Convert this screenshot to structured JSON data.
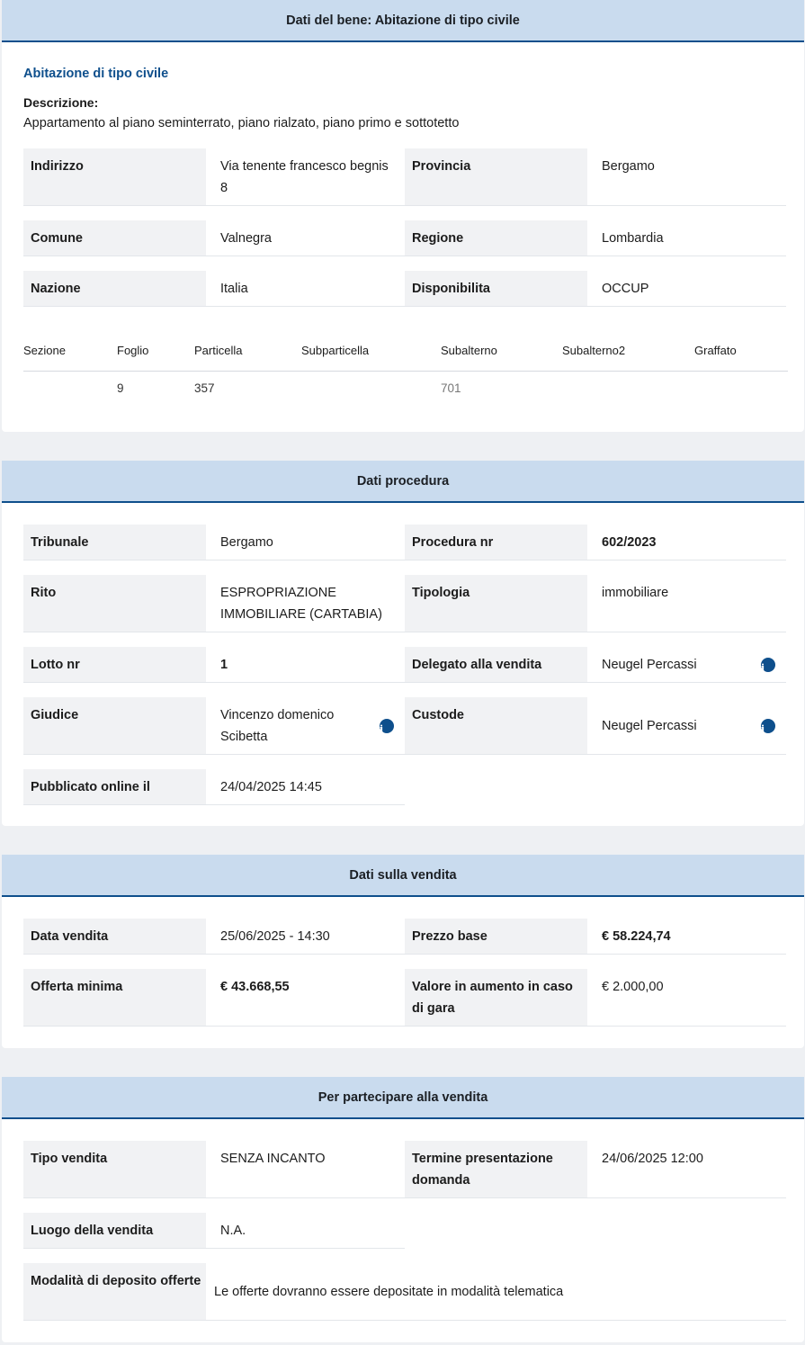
{
  "bene": {
    "header": "Dati del bene: Abitazione di tipo civile",
    "subtitle": "Abitazione di tipo civile",
    "description_label": "Descrizione:",
    "description": "Appartamento al piano seminterrato, piano rialzato, piano primo e sottotetto",
    "fields": {
      "indirizzo_label": "Indirizzo",
      "indirizzo_value": "Via tenente francesco begnis 8",
      "provincia_label": "Provincia",
      "provincia_value": "Bergamo",
      "comune_label": "Comune",
      "comune_value": "Valnegra",
      "regione_label": "Regione",
      "regione_value": "Lombardia",
      "nazione_label": "Nazione",
      "nazione_value": "Italia",
      "disponibilita_label": "Disponibilita",
      "disponibilita_value": "OCCUP"
    },
    "catasto": {
      "headers": [
        "Sezione",
        "Foglio",
        "Particella",
        "Subparticella",
        "Subalterno",
        "Subalterno2",
        "Graffato"
      ],
      "row": [
        "",
        "9",
        "357",
        "",
        "701",
        "",
        ""
      ]
    }
  },
  "procedura": {
    "header": "Dati procedura",
    "tribunale_label": "Tribunale",
    "tribunale_value": "Bergamo",
    "procedura_nr_label": "Procedura nr",
    "procedura_nr_value": "602/2023",
    "rito_label": "Rito",
    "rito_value": "ESPROPRIAZIONE IMMOBILIARE (CARTABIA)",
    "tipologia_label": "Tipologia",
    "tipologia_value": "immobiliare",
    "lotto_label": "Lotto nr",
    "lotto_value": "1",
    "delegato_label": "Delegato alla vendita",
    "delegato_value": "Neugel Percassi",
    "giudice_label": "Giudice",
    "giudice_value": "Vincenzo domenico Scibetta",
    "custode_label": "Custode",
    "custode_value": "Neugel Percassi",
    "pubblicato_label": "Pubblicato online il",
    "pubblicato_value": "24/04/2025 14:45"
  },
  "vendita": {
    "header": "Dati sulla vendita",
    "data_label": "Data vendita",
    "data_value": "25/06/2025 - 14:30",
    "prezzo_label": "Prezzo base",
    "prezzo_value": "€ 58.224,74",
    "offerta_label": "Offerta minima",
    "offerta_value": "€ 43.668,55",
    "aumento_label": "Valore in aumento in caso di gara",
    "aumento_value": "€ 2.000,00"
  },
  "partecipare": {
    "header": "Per partecipare alla vendita",
    "tipo_label": "Tipo vendita",
    "tipo_value": "SENZA INCANTO",
    "termine_label": "Termine presentazione domanda",
    "termine_value": "24/06/2025 12:00",
    "luogo_label": "Luogo della vendita",
    "luogo_value": "N.A.",
    "modalita_label": "Modalità di deposito offerte",
    "modalita_value": "Le offerte dovranno essere depositate in modalità telematica"
  },
  "icons": {
    "info": "info-icon"
  },
  "colors": {
    "header_bg": "#c9dbee",
    "accent": "#0e4f8c",
    "label_bg": "#f1f2f4"
  }
}
